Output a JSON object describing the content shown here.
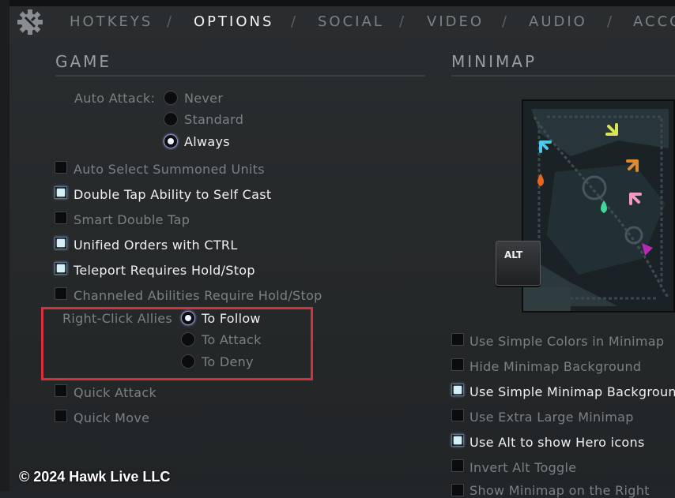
{
  "tabs": [
    "HOTKEYS",
    "OPTIONS",
    "SOCIAL",
    "VIDEO",
    "AUDIO",
    "ACCO"
  ],
  "tab_separator": "/",
  "game": {
    "title": "GAME",
    "auto_attack": {
      "label": "Auto Attack:",
      "options": [
        "Never",
        "Standard",
        "Always"
      ],
      "selected": "Always"
    },
    "checkboxes_top": [
      {
        "label": "Auto Select Summoned Units",
        "checked": false
      },
      {
        "label": "Double Tap Ability to Self Cast",
        "checked": true
      },
      {
        "label": "Smart Double Tap",
        "checked": false
      },
      {
        "label": "Unified Orders with CTRL",
        "checked": true
      },
      {
        "label": "Teleport Requires Hold/Stop",
        "checked": true
      },
      {
        "label": "Channeled Abilities Require Hold/Stop",
        "checked": false
      }
    ],
    "right_click": {
      "label": "Right-Click Allies",
      "options": [
        "To Follow",
        "To Attack",
        "To Deny"
      ],
      "selected": "To Follow"
    },
    "checkboxes_bottom": [
      {
        "label": "Quick Attack",
        "checked": false
      },
      {
        "label": "Quick Move",
        "checked": false
      }
    ]
  },
  "minimap": {
    "title": "MINIMAP",
    "alt_key_label": "ALT",
    "checkboxes": [
      {
        "label": "Use Simple Colors in Minimap",
        "checked": false
      },
      {
        "label": "Hide Minimap Background",
        "checked": false
      },
      {
        "label": "Use Simple Minimap Background",
        "checked": true
      },
      {
        "label": "Use Extra Large Minimap",
        "checked": false
      },
      {
        "label": "Use Alt to show Hero icons",
        "checked": true
      },
      {
        "label": "Invert Alt Toggle",
        "checked": false
      },
      {
        "label": "Show Minimap on the Right",
        "checked": false
      }
    ]
  },
  "copyright": "© 2024 Hawk Live LLC",
  "colors": {
    "highlight": "#d8303a",
    "accent_check": "#d6eef6"
  }
}
